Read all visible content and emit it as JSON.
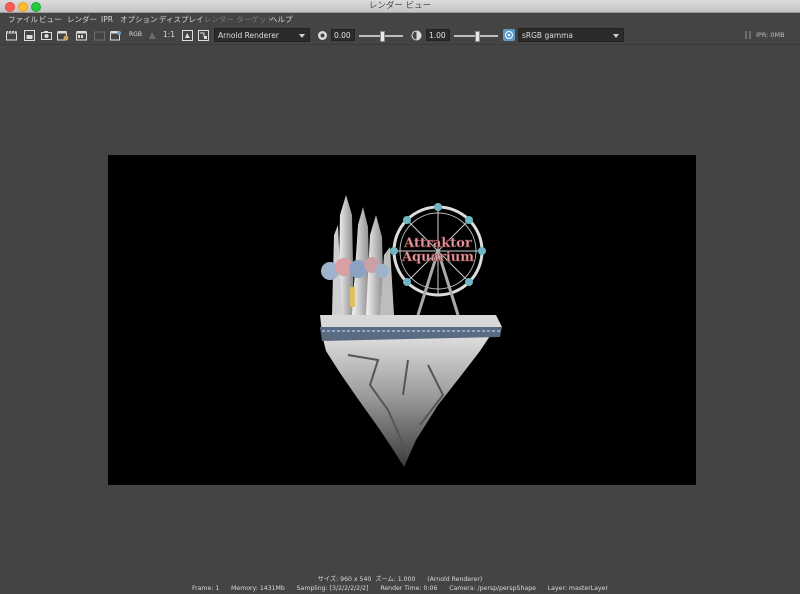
{
  "window": {
    "title": "レンダー ビュー"
  },
  "menu": {
    "items": [
      {
        "label": "ファイル",
        "enabled": true
      },
      {
        "label": "ビュー",
        "enabled": true
      },
      {
        "label": "レンダー",
        "enabled": true
      },
      {
        "label": "IPR",
        "enabled": true
      },
      {
        "label": "オプション",
        "enabled": true
      },
      {
        "label": "ディスプレイ",
        "enabled": true
      },
      {
        "label": "レンダー ターゲット",
        "enabled": false
      },
      {
        "label": "ヘルプ",
        "enabled": true
      }
    ]
  },
  "toolbar": {
    "rgb_label": "RGB",
    "ratio_label": "1:1",
    "renderer": "Arnold Renderer",
    "exposure_value": "0.00",
    "gamma_value": "1.00",
    "colorspace": "sRGB gamma",
    "ipr_memory": "IPR: 0MB",
    "exposure_slider": 0.5,
    "gamma_slider": 0.5
  },
  "render_info": {
    "line1": "サイズ: 960 x 540  ズーム: 1.000      (Arnold Renderer)",
    "line2": "Frame: 1      Memory: 1431Mb      Sampling: [3/2/2/2/2/2]      Render Time: 0:06      Camera: /persp/perspShape      Layer: masterLayer"
  },
  "render_image": {
    "sign_text": [
      "Attraktor",
      "Aquarium"
    ],
    "accent_color": "#e49aa0"
  }
}
